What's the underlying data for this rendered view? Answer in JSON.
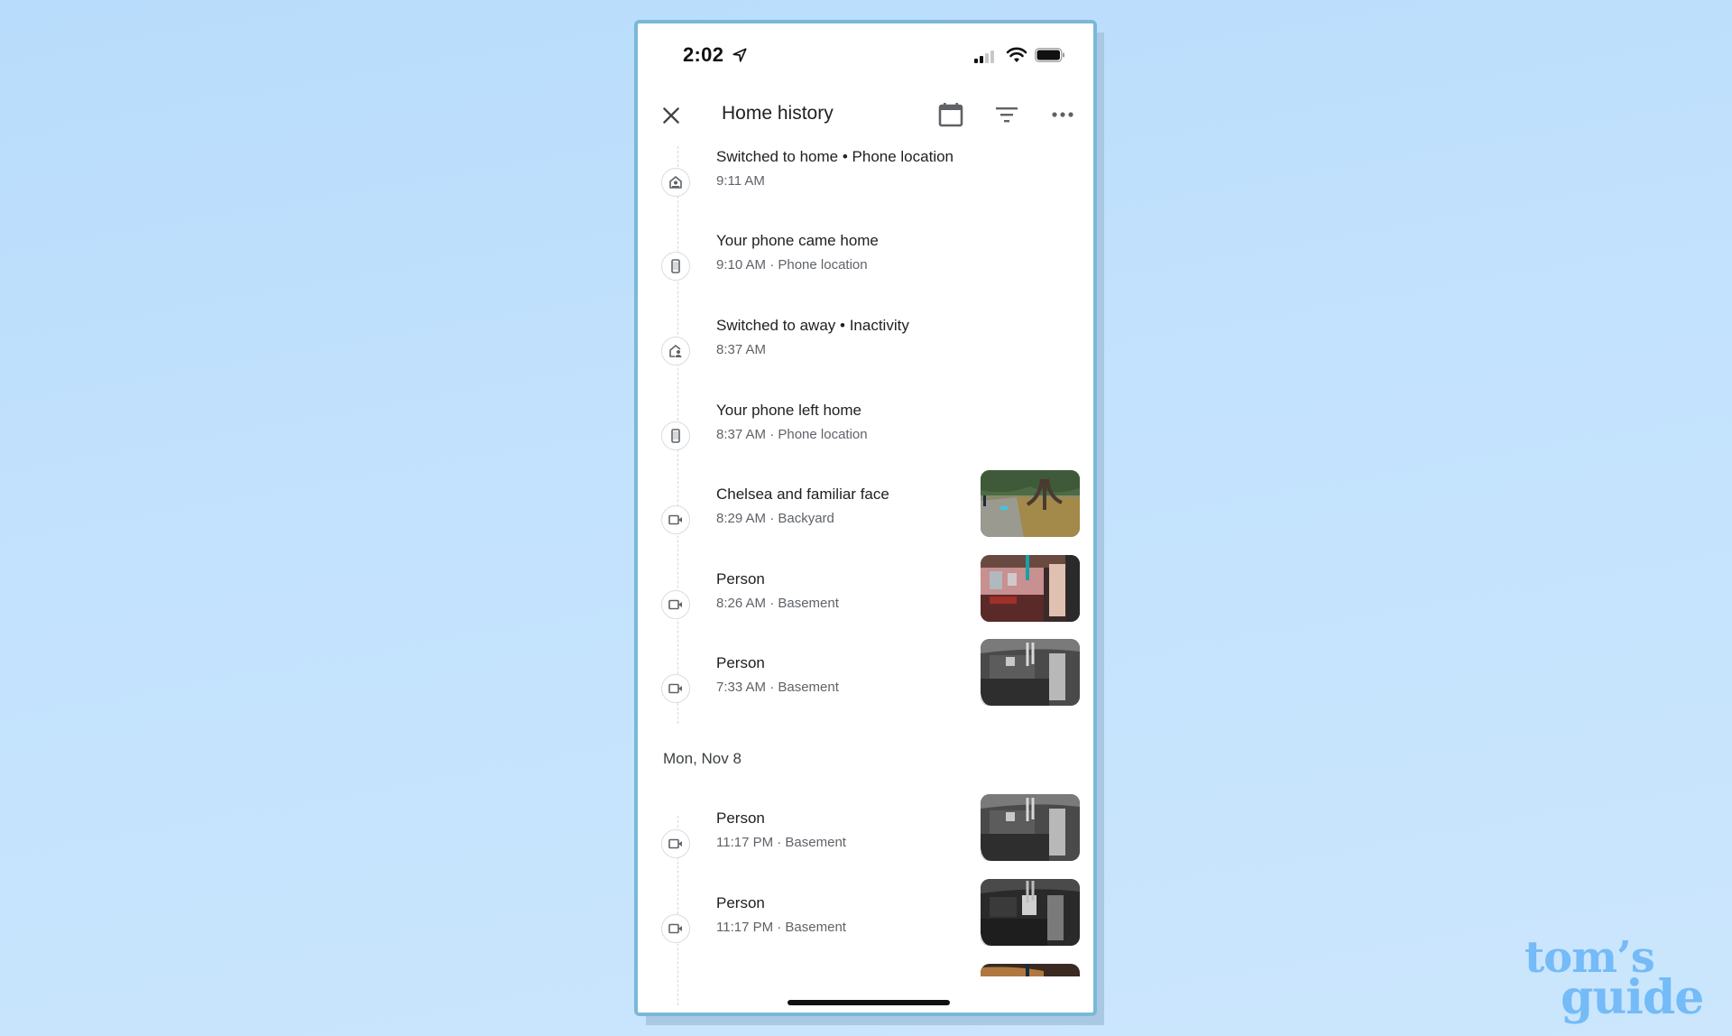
{
  "status_bar": {
    "time": "2:02",
    "location_icon": "location-arrow-icon",
    "signal_bars_filled": 2,
    "signal_bars_total": 4,
    "wifi_icon": "wifi-icon",
    "battery_level": 1.0
  },
  "header": {
    "title": "Home history",
    "close_icon": "close-icon",
    "calendar_icon": "calendar-icon",
    "filter_icon": "filter-icon",
    "more_icon": "more-horizontal-icon"
  },
  "events": [
    {
      "title": "Switched to home • Phone location",
      "subtitle": "9:11 AM",
      "icon": "home-mode-icon",
      "thumbnail": null
    },
    {
      "title": "Your phone came home",
      "subtitle": "9:10 AM · Phone location",
      "icon": "phone-icon",
      "thumbnail": null
    },
    {
      "title": "Switched to away • Inactivity",
      "subtitle": "8:37 AM",
      "icon": "away-mode-icon",
      "thumbnail": null
    },
    {
      "title": "Your phone left home",
      "subtitle": "8:37 AM · Phone location",
      "icon": "phone-icon",
      "thumbnail": null
    },
    {
      "title": "Chelsea and familiar face",
      "subtitle": "8:29 AM · Backyard",
      "icon": "video-camera-icon",
      "thumbnail": "backyard"
    },
    {
      "title": "Person",
      "subtitle": "8:26 AM · Basement",
      "icon": "video-camera-icon",
      "thumbnail": "basement-color"
    },
    {
      "title": "Person",
      "subtitle": "7:33 AM · Basement",
      "icon": "video-camera-icon",
      "thumbnail": "basement-gray"
    }
  ],
  "date_header": "Mon, Nov 8",
  "events_prev_day": [
    {
      "title": "Person",
      "subtitle": "11:17 PM · Basement",
      "icon": "video-camera-icon",
      "thumbnail": "basement-gray"
    },
    {
      "title": "Person",
      "subtitle": "11:17 PM · Basement",
      "icon": "video-camera-icon",
      "thumbnail": "basement-dark"
    }
  ],
  "watermark": {
    "line1": "tom’s",
    "line2": "guide"
  },
  "colors": {
    "background": "#c3e2fd",
    "frame_border": "#7ab8d8",
    "text_primary": "#202124",
    "text_secondary": "#5f6368",
    "icon_gray": "#5f6368",
    "watermark": "#74bbf7"
  }
}
